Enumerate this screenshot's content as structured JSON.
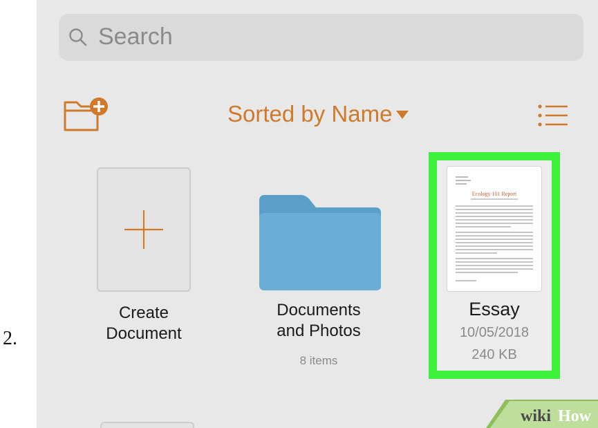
{
  "step": {
    "number": "2."
  },
  "search": {
    "placeholder": "Search"
  },
  "toolbar": {
    "sort_label": "Sorted by Name"
  },
  "items": [
    {
      "label_line1": "Create",
      "label_line2": "Document"
    },
    {
      "label_line1": "Documents",
      "label_line2": "and Photos",
      "count": "8 items"
    },
    {
      "name": "Essay",
      "date": "10/05/2018",
      "size": "240 KB",
      "thumbnail_title": "Ecology 101 Report"
    }
  ],
  "watermark": {
    "brand_a": "wiki",
    "brand_b": "How"
  },
  "colors": {
    "accent": "#cf7a2a",
    "folder": "#6aaed6",
    "highlight": "#3cf03c",
    "background": "#e8e8e8"
  },
  "icons": {
    "search": "search-icon",
    "new_folder": "folder-plus-icon",
    "sort_caret": "caret-down-icon",
    "list_view": "list-view-icon",
    "create": "plus-icon",
    "folder": "folder-icon"
  }
}
